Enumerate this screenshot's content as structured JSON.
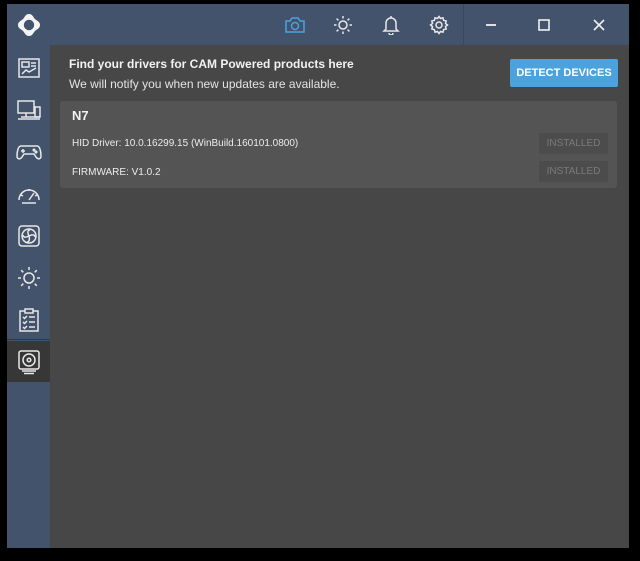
{
  "colors": {
    "sidebar_bg": "#43536b",
    "content_bg": "#474747",
    "card_bg": "#545454",
    "accent": "#4aa3df",
    "active_icon": "#4aa3df",
    "icon": "#e8e8e8"
  },
  "sidebar": {
    "logo_icon": "cam-logo-icon",
    "items": [
      {
        "icon": "dashboard-icon",
        "active": false
      },
      {
        "icon": "pc-monitor-icon",
        "active": false
      },
      {
        "icon": "gamepad-icon",
        "active": false
      },
      {
        "icon": "speedometer-icon",
        "active": false
      },
      {
        "icon": "fan-icon",
        "active": false
      },
      {
        "icon": "lighting-sun-icon",
        "active": false
      },
      {
        "icon": "checklist-icon",
        "active": false
      },
      {
        "icon": "drivers-disc-icon",
        "active": true
      }
    ]
  },
  "topbar": {
    "icons": [
      "camera-icon",
      "brightness-icon",
      "bell-icon",
      "gear-icon"
    ],
    "active_icon": "camera-icon",
    "window_controls": [
      "minimize-icon",
      "maximize-icon",
      "close-icon"
    ]
  },
  "banner": {
    "title": "Find your drivers for CAM Powered products here",
    "subtitle": "We will notify you when new updates are available.",
    "detect_label": "DETECT DEVICES"
  },
  "device": {
    "name": "N7",
    "drivers": [
      {
        "label": "HID Driver: 10.0.16299.15 (WinBuild.160101.0800)",
        "status": "INSTALLED"
      },
      {
        "label": "FIRMWARE: V1.0.2",
        "status": "INSTALLED"
      }
    ]
  }
}
